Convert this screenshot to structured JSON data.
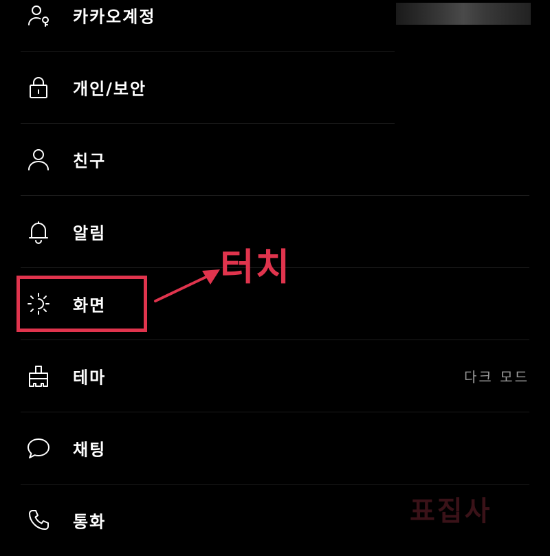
{
  "settings": {
    "items": [
      {
        "label": "카카오계정",
        "icon": "person-key-icon"
      },
      {
        "label": "개인/보안",
        "icon": "lock-icon"
      },
      {
        "label": "친구",
        "icon": "person-icon"
      },
      {
        "label": "알림",
        "icon": "bell-icon"
      },
      {
        "label": "화면",
        "icon": "sun-icon"
      },
      {
        "label": "테마",
        "icon": "brush-icon",
        "value": "다크 모드"
      },
      {
        "label": "채팅",
        "icon": "chat-bubble-icon"
      },
      {
        "label": "통화",
        "icon": "phone-icon"
      }
    ]
  },
  "annotation": {
    "text": "터치",
    "color": "#e0344d"
  },
  "watermark": {
    "text": "표집사"
  },
  "colors": {
    "background": "#000000",
    "text": "#ffffff",
    "secondary_text": "#9a9a9a",
    "divider": "#1c1c1c",
    "highlight": "#e0344d"
  }
}
